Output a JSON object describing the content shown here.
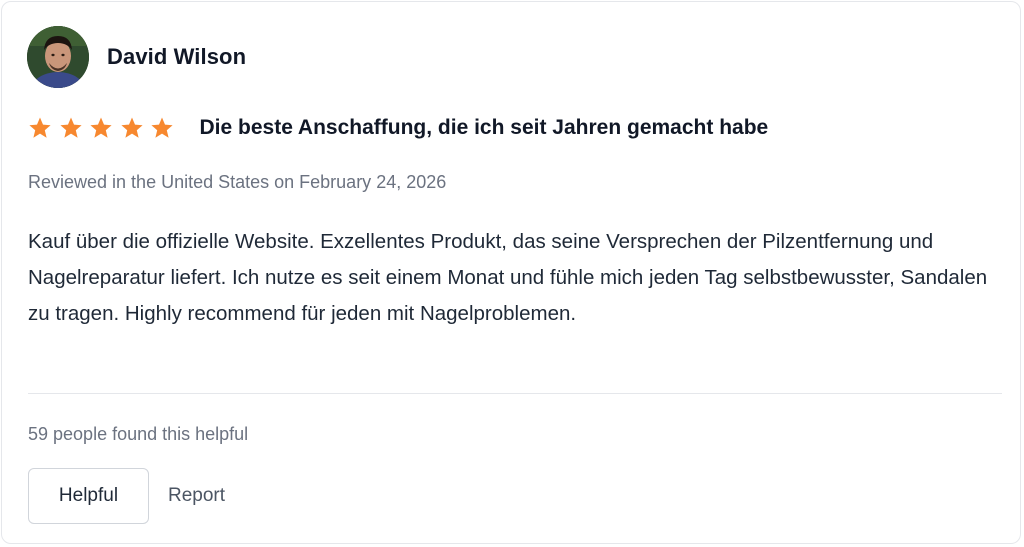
{
  "review": {
    "author": {
      "name": "David Wilson",
      "avatar_icon": "user-photo"
    },
    "rating": {
      "value": 5,
      "max": 5,
      "star_color": "#f7882f"
    },
    "title": "Die beste Anschaffung, die ich seit Jahren gemacht habe",
    "meta": "Reviewed in the United States on February 24, 2026",
    "body": "Kauf über die offizielle Website. Exzellentes Produkt, das seine Versprechen der Pilzentfernung und Nagelreparatur liefert. Ich nutze es seit einem Monat und fühle mich jeden Tag selbstbewusster, Sandalen zu tragen. Highly recommend für jeden mit Nagelproblemen.",
    "helpful_count_text": "59 people found this helpful",
    "actions": {
      "helpful_label": "Helpful",
      "report_label": "Report"
    }
  }
}
